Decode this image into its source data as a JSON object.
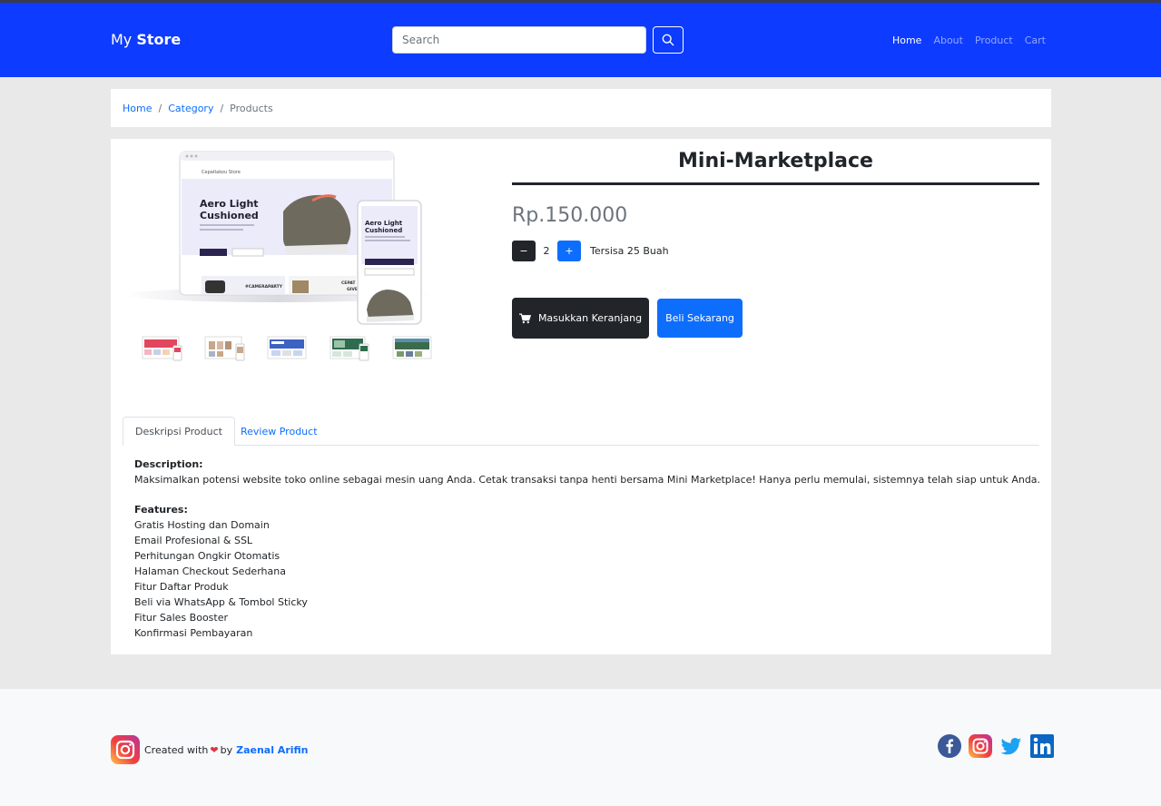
{
  "navbar": {
    "brand_prefix": "My",
    "brand_name": "Store",
    "search_placeholder": "Search",
    "links": [
      "Home",
      "About",
      "Product",
      "Cart"
    ],
    "active_link": "Home",
    "background": "#0d3bff"
  },
  "breadcrumb": {
    "items": [
      "Home",
      "Category",
      "Products"
    ]
  },
  "product": {
    "title": "Mini-Marketplace",
    "price": "Rp.150.000",
    "quantity": "2",
    "minus_label": "−",
    "plus_label": "+",
    "stock": "Tersisa 25 Buah",
    "add_to_cart_label": "Masukkan Keranjang",
    "buy_now_label": "Beli Sekarang",
    "image_text": {
      "store_name": "Cepatlakou Store",
      "headline_line1": "Aero Light",
      "headline_line2": "Cushioned",
      "promo_tag": "#CAMERAPARTY",
      "promo2": "CEPAT",
      "promo3": "GIVE"
    }
  },
  "tabs": {
    "active": "Deskripsi Product",
    "inactive": "Review Product"
  },
  "description": {
    "heading": "Description:",
    "text": "Maksimalkan potensi website toko online sebagai mesin uang Anda. Cetak transaksi tanpa henti bersama Mini Marketplace! Hanya perlu memulai, sistemnya telah siap untuk Anda.",
    "features_heading": "Features:",
    "features": [
      "Gratis Hosting dan Domain",
      "Email Profesional & SSL",
      "Perhitungan Ongkir Otomatis",
      "Halaman Checkout Sederhana",
      "Fitur Daftar Produk",
      "Beli via WhatsApp & Tombol Sticky",
      "Fitur Sales Booster",
      "Konfirmasi Pembayaran"
    ]
  },
  "footer": {
    "created_with": "Created with",
    "by": "by",
    "author": "Zaenal Arifin",
    "social_icons": [
      "facebook-icon",
      "instagram-icon",
      "twitter-icon",
      "linkedin-icon"
    ]
  }
}
